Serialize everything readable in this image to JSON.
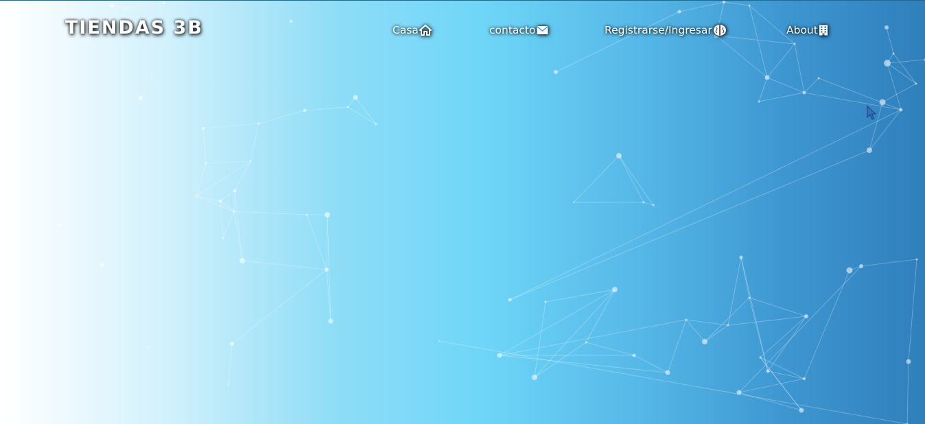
{
  "header": {
    "brand": "TIENDAS 3B",
    "nav": [
      {
        "label": "Casa",
        "icon": "home-icon"
      },
      {
        "label": "contacto",
        "icon": "envelope-icon"
      },
      {
        "label": "Registrarse/Ingresar",
        "icon": "brain-icon"
      },
      {
        "label": "About",
        "icon": "building-icon"
      }
    ]
  },
  "colors": {
    "gradient_start": "#ffffff",
    "gradient_mid": "#6fd6f8",
    "gradient_end": "#2f7fbb",
    "text": "#ffffff",
    "network_lines": "#ffffff"
  },
  "background": {
    "decoration": "particle-network"
  }
}
